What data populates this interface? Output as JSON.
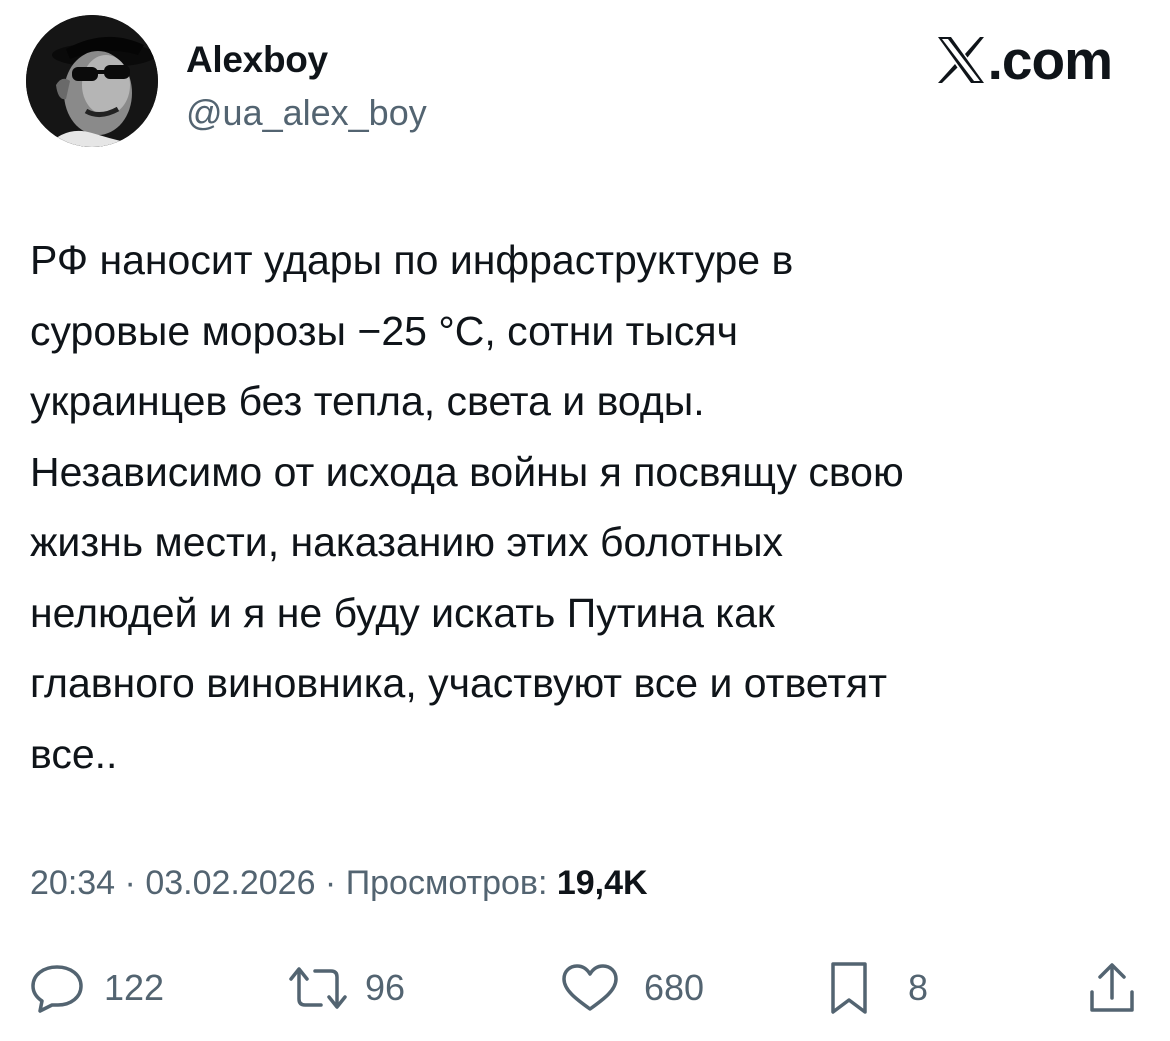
{
  "author": {
    "display_name": "Alexboy",
    "handle": "@ua_alex_boy",
    "avatar_icon": "profile-avatar"
  },
  "brand": {
    "icon": "x-logo-icon",
    "text": ".com"
  },
  "tweet": {
    "lines": [
      "РФ наносит удары по инфраструктуре в",
      "суровые морозы −25 °C, сотни тысяч",
      "украинцев без тепла, света и воды.",
      "Независимо от исхода войны я посвящу свою",
      "жизнь мести, наказанию этих болотных",
      "нелюдей и я не буду искать Путина как",
      "главного виновника, участвуют все и ответят",
      "все.."
    ]
  },
  "meta": {
    "time": "20:34",
    "separator": " · ",
    "date": "03.02.2026",
    "views_label": "Просмотров:",
    "views_value": "19,4K"
  },
  "actions": {
    "replies": {
      "icon": "reply-icon",
      "count": "122"
    },
    "reposts": {
      "icon": "repost-icon",
      "count": "96"
    },
    "likes": {
      "icon": "heart-icon",
      "count": "680"
    },
    "bookmarks": {
      "icon": "bookmark-icon",
      "count": "8"
    },
    "share": {
      "icon": "share-icon"
    }
  },
  "colors": {
    "text_primary": "#0f1419",
    "text_secondary": "#536471",
    "background": "#ffffff"
  }
}
